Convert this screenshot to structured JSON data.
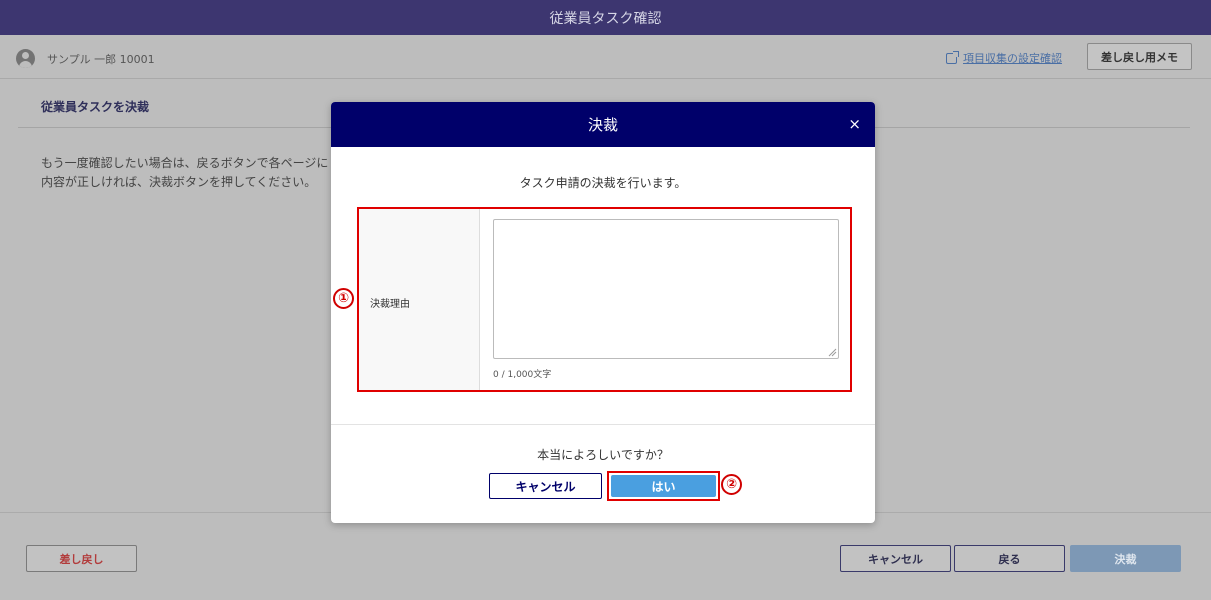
{
  "app": {
    "title": "従業員タスク確認"
  },
  "userbar": {
    "username": "サンプル 一郎 10001",
    "settings_link": "項目収集の設定確認",
    "memo_button": "差し戻し用メモ"
  },
  "page": {
    "section_title": "従業員タスクを決裁",
    "instruction": "もう一度確認したい場合は、戻るボタンで各ページに\n内容が正しければ、決裁ボタンを押してください。"
  },
  "footer": {
    "send_back": "差し戻し",
    "cancel": "キャンセル",
    "back": "戻る",
    "decide": "決裁"
  },
  "modal": {
    "title": "決裁",
    "close": "×",
    "description": "タスク申請の決裁を行います。",
    "reason_label": "決裁理由",
    "reason_value": "",
    "char_count": "0 / 1,000文字",
    "confirm_question": "本当によろしいですか？",
    "cancel_button": "キャンセル",
    "yes_button": "はい"
  },
  "annotations": {
    "marker_1": "①",
    "marker_2": "②"
  },
  "colors": {
    "header": "#3d3670",
    "modal_header": "#00006a",
    "primary_button": "#4a9fe0",
    "highlight": "#e00000"
  }
}
